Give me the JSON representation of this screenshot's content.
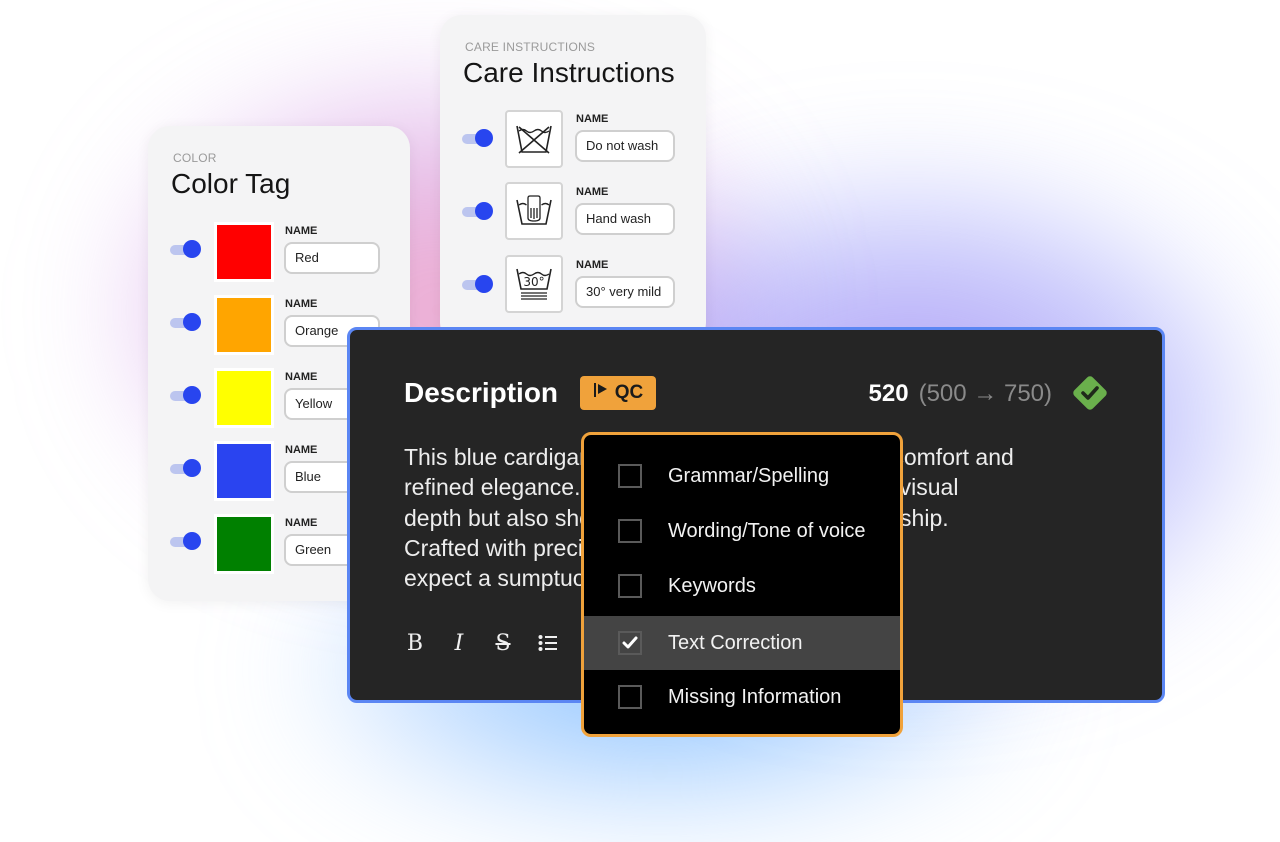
{
  "color_card": {
    "eyebrow": "COLOR",
    "title": "Color Tag",
    "field_label": "NAME",
    "items": [
      {
        "name": "Red",
        "color": "#ff0000",
        "enabled": true
      },
      {
        "name": "Orange",
        "color": "#ffa500",
        "enabled": true
      },
      {
        "name": "Yellow",
        "color": "#ffff00",
        "enabled": true
      },
      {
        "name": "Blue",
        "color": "#2a44f0",
        "enabled": true
      },
      {
        "name": "Green",
        "color": "#008000",
        "enabled": true
      }
    ]
  },
  "care_card": {
    "eyebrow": "CARE INSTRUCTIONS",
    "title": "Care Instructions",
    "field_label": "NAME",
    "items": [
      {
        "name": "Do not wash",
        "icon": "do-not-wash-icon",
        "enabled": true
      },
      {
        "name": "Hand wash",
        "icon": "hand-wash-icon",
        "enabled": true
      },
      {
        "name": "30° very mild",
        "icon": "wash-30-very-mild-icon",
        "icon_text": "30°",
        "enabled": true
      }
    ]
  },
  "description": {
    "title": "Description",
    "qc_label": "QC",
    "count": "520",
    "range": "(500 → 750)",
    "status": "valid",
    "status_color": "#6ab04c",
    "text_lines": [
      "This blue cardigan seamlessly blends everyday comfort and",
      "refined elegance. Its textured knit not only offers visual",
      "depth but also showcases high-quality craftsmanship.",
      "Crafted with precision and care, wearers can",
      "expect a sumptuous experience from this piece."
    ],
    "toolbar": [
      "bold",
      "italic",
      "strikethrough",
      "bulleted-list"
    ]
  },
  "qc_menu": {
    "items": [
      {
        "label": "Grammar/Spelling",
        "checked": false
      },
      {
        "label": "Wording/Tone of voice",
        "checked": false
      },
      {
        "label": "Keywords",
        "checked": false
      },
      {
        "label": "Text Correction",
        "checked": true
      },
      {
        "label": "Missing Information",
        "checked": false
      }
    ]
  },
  "colors": {
    "accent_orange": "#f0a23b",
    "toggle_blue": "#2845ef",
    "panel_border_blue": "#5b86f3"
  }
}
